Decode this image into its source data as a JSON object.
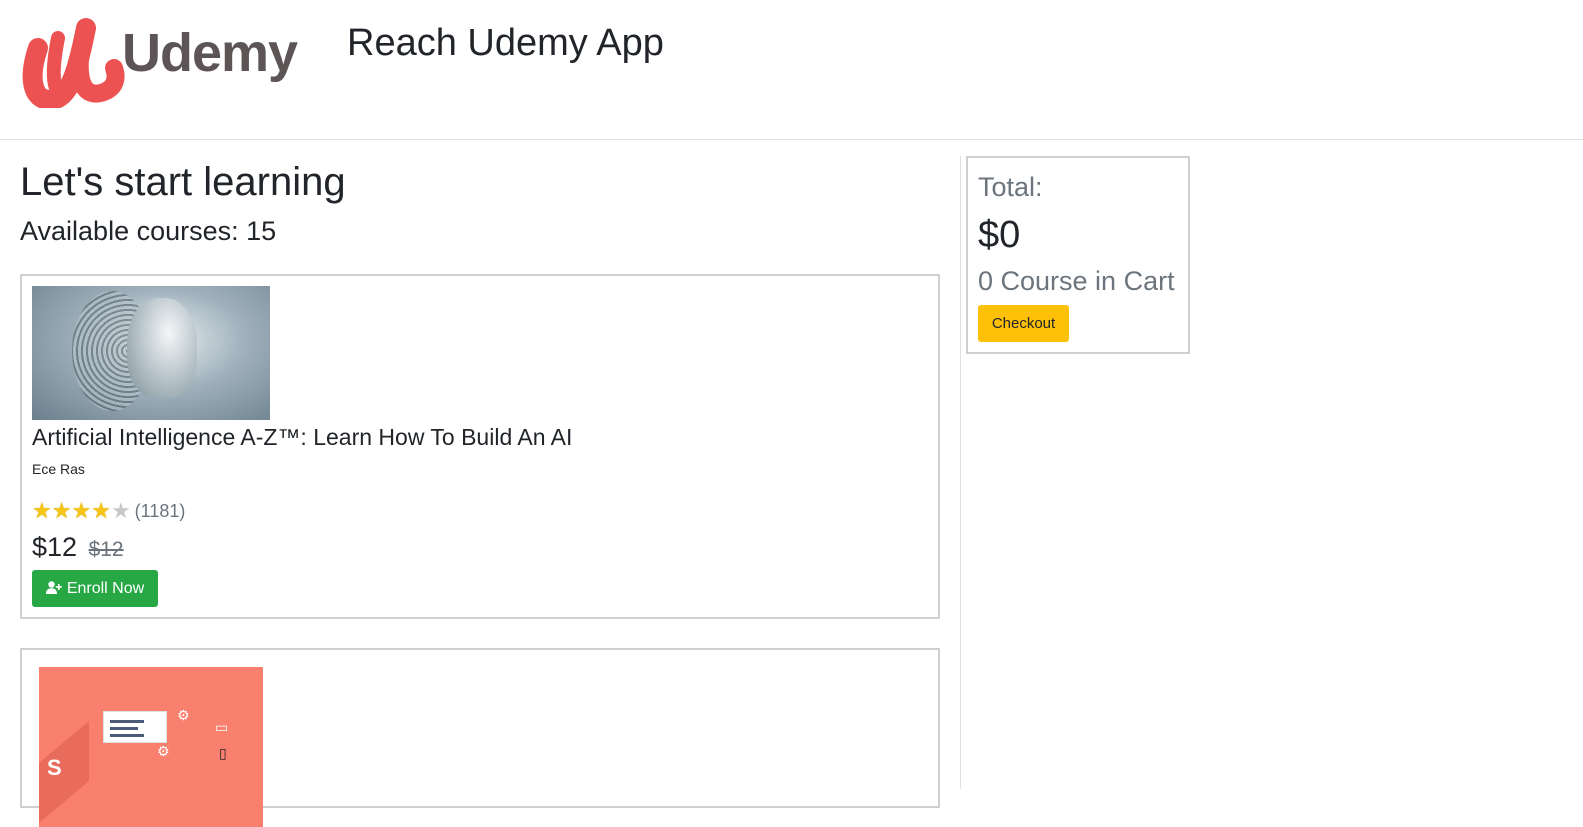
{
  "header": {
    "logo_text": "Udemy",
    "app_title": "Reach Udemy App",
    "brand_color": "#ec5252"
  },
  "main": {
    "heading": "Let's start learning",
    "available_label": "Available courses: 15"
  },
  "courses": [
    {
      "title": "Artificial Intelligence A-Z™: Learn How To Build An AI",
      "author": "Ece Ras",
      "rating_stars": 4,
      "rating_max": 5,
      "rating_count": "(1181)",
      "price": "$12",
      "old_price": "$12",
      "button_label": "Enroll Now",
      "button_icon": "user-plus-icon"
    },
    {
      "title": "",
      "thumbnail": "web-development-illustration"
    }
  ],
  "cart": {
    "label": "Total:",
    "total": "$0",
    "count_text": "0 Course in Cart",
    "checkout_label": "Checkout",
    "checkout_color": "#ffc107"
  },
  "colors": {
    "enroll": "#28a745",
    "muted": "#6c757d"
  }
}
